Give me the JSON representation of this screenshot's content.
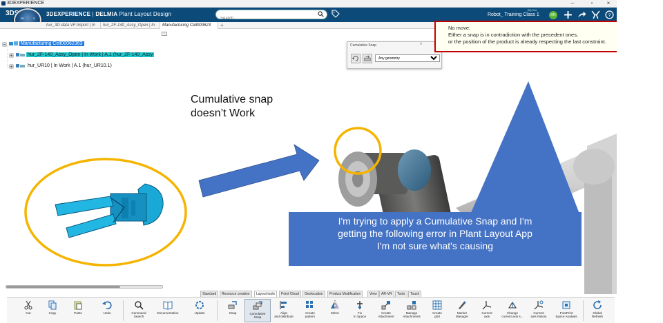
{
  "os_window": {
    "title": "3DEXPERIENCE"
  },
  "header": {
    "brand_prefix": "3DEXPERIENCE",
    "brand_separator": " | ",
    "brand_company": "DELMIA",
    "brand_app": " Plant Layout Design",
    "search_placeholder": "Search",
    "user_context": "Robot_ Training Class 1",
    "user_subtext": "(D) Hur",
    "avatar_initials": "HH",
    "compass_top_left": "3D",
    "compass_top_right": "V",
    "compass_bottom": "V.R"
  },
  "tabs": [
    {
      "label": "hur_3D data VF Import | In",
      "active": false
    },
    {
      "label": "hur_2F-140_Assy_Open | In",
      "active": false
    },
    {
      "label": "Manufacturing Cell000623",
      "active": true
    }
  ],
  "tree": {
    "root": "Manufacturing Cell00062363",
    "children": [
      "hur_2F-140_Assy_Open | In Work | A.1 (hur_2F-140_Assy",
      "hur_UR10 | In Work | A.1 (hur_UR10.1)"
    ]
  },
  "snap_dialog": {
    "title": "Cumulative Snap",
    "help": "?",
    "close": "×",
    "selected_option": "Any geometry"
  },
  "error_tooltip": {
    "lines": [
      "No move:",
      "Either a snap is in contradiction with the precedent ones,",
      "or the position of the product is already respecting the last constraint."
    ]
  },
  "annotations": {
    "left_text_line1": "Cumulative snap",
    "left_text_line2": "doesn’t Work",
    "callout_line1": "I'm trying to apply a Cumulative Snap and I'm",
    "callout_line2": "getting the following error in Plant Layout App",
    "callout_line3": "I'm not sure what's causing"
  },
  "section_tabs": [
    {
      "label": "Standard",
      "active": false
    },
    {
      "label": "Resource creation",
      "active": false
    },
    {
      "label": "Layout tools",
      "active": true
    },
    {
      "label": "Point Cloud",
      "active": false
    },
    {
      "label": "Geolocation",
      "active": false
    },
    {
      "label": "Product Modification",
      "active": false
    },
    {
      "label": "View",
      "active": false
    },
    {
      "label": "AR-VR",
      "active": false
    },
    {
      "label": "Tools",
      "active": false
    },
    {
      "label": "Touch",
      "active": false
    }
  ],
  "tools": [
    {
      "l1": "Cut",
      "l2": "",
      "icon": "scissors-icon"
    },
    {
      "l1": "Copy",
      "l2": "",
      "icon": "copy-icon"
    },
    {
      "l1": "Paste",
      "l2": "",
      "icon": "paste-icon"
    },
    {
      "l1": "Undo",
      "l2": "",
      "icon": "undo-icon"
    },
    {
      "l1": "Command",
      "l2": "Search",
      "icon": "command-search-icon"
    },
    {
      "l1": "Documentation",
      "l2": "",
      "icon": "book-icon"
    },
    {
      "l1": "Update",
      "l2": "",
      "icon": "update-icon"
    },
    {
      "l1": "Snap",
      "l2": "",
      "icon": "snap-icon"
    },
    {
      "l1": "Cumulative",
      "l2": "Snap",
      "icon": "cumulative-snap-icon"
    },
    {
      "l1": "Align",
      "l2": "and distribute",
      "icon": "align-icon"
    },
    {
      "l1": "Create",
      "l2": "pattern",
      "icon": "pattern-icon"
    },
    {
      "l1": "Mirror",
      "l2": "",
      "icon": "mirror-icon"
    },
    {
      "l1": "Fix",
      "l2": "In Space",
      "icon": "fix-icon"
    },
    {
      "l1": "Create",
      "l2": "Attachment",
      "icon": "attachment-icon"
    },
    {
      "l1": "Manage",
      "l2": "Attachments",
      "icon": "manage-attachments-icon"
    },
    {
      "l1": "Create",
      "l2": "grid",
      "icon": "grid-icon"
    },
    {
      "l1": "Marker",
      "l2": "Manager",
      "icon": "marker-icon"
    },
    {
      "l1": "Current",
      "l2": "axis",
      "icon": "axis-icon"
    },
    {
      "l1": "Change",
      "l2": "current axis s...",
      "icon": "change-axis-icon"
    },
    {
      "l1": "Current",
      "l2": "axis history",
      "icon": "axis-history-icon"
    },
    {
      "l1": "FootPrint",
      "l2": "Space Analysis",
      "icon": "footprint-icon"
    },
    {
      "l1": "Global",
      "l2": "Refresh",
      "icon": "refresh-icon"
    }
  ],
  "colors": {
    "header_bg": "#0c4a7a",
    "highlight_yellow": "#f5b400",
    "arrow_blue": "#4472c4",
    "error_border": "#c00000",
    "gripper_cyan": "#1aa9d6"
  }
}
